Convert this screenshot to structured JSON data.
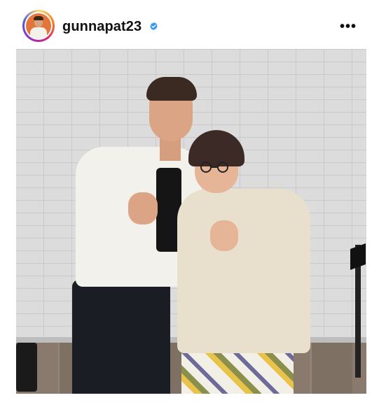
{
  "post": {
    "username": "gunnapat23",
    "verified": true,
    "more_label": "•••",
    "photo": {
      "subject_icon": "people-photo",
      "shows": "two-people-mini-heart-gesture"
    }
  },
  "colors": {
    "verified_badge": "#3897f0",
    "text": "#111111",
    "background": "#ffffff"
  }
}
